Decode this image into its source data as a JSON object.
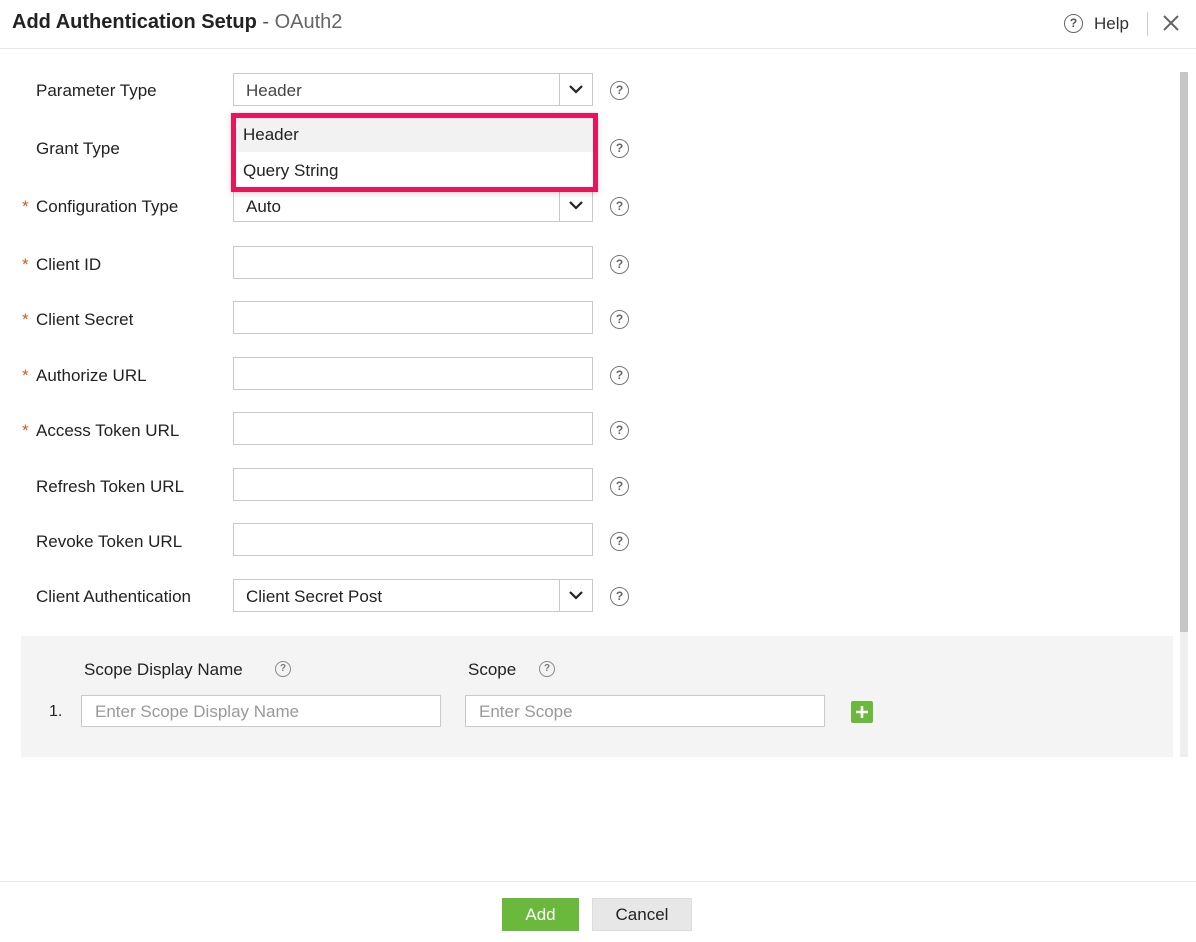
{
  "header": {
    "title_main": "Add Authentication Setup",
    "title_separator": " - ",
    "title_sub": "OAuth2",
    "help_label": "Help"
  },
  "form": {
    "parameter_type": {
      "label": "Parameter Type",
      "value": "Header",
      "required": false
    },
    "grant_type": {
      "label": "Grant Type",
      "required": false
    },
    "configuration_type": {
      "label": "Configuration Type",
      "value": "Auto",
      "required": true
    },
    "client_id": {
      "label": "Client ID",
      "value": "",
      "required": true
    },
    "client_secret": {
      "label": "Client Secret",
      "value": "",
      "required": true
    },
    "authorize_url": {
      "label": "Authorize URL",
      "value": "",
      "required": true
    },
    "access_token_url": {
      "label": "Access Token URL",
      "value": "",
      "required": true
    },
    "refresh_token_url": {
      "label": "Refresh Token URL",
      "value": "",
      "required": false
    },
    "revoke_token_url": {
      "label": "Revoke Token URL",
      "value": "",
      "required": false
    },
    "client_authentication": {
      "label": "Client Authentication",
      "value": "Client Secret Post",
      "required": false
    }
  },
  "required_marker": "*",
  "help_glyph": "?",
  "dropdown": {
    "options": [
      "Header",
      "Query String"
    ],
    "highlight_color": "#e8155a"
  },
  "scope": {
    "display_name_header": "Scope Display Name",
    "scope_header": "Scope",
    "rows": [
      {
        "number": "1.",
        "display_name_placeholder": "Enter Scope Display Name",
        "scope_placeholder": "Enter Scope"
      }
    ]
  },
  "footer": {
    "add_label": "Add",
    "cancel_label": "Cancel"
  },
  "colors": {
    "primary_green": "#6ab93c",
    "required_orange": "#c0612b"
  },
  "icons": [
    "help-circle-icon",
    "close-icon",
    "chevron-down-icon",
    "question-icon",
    "plus-icon"
  ]
}
